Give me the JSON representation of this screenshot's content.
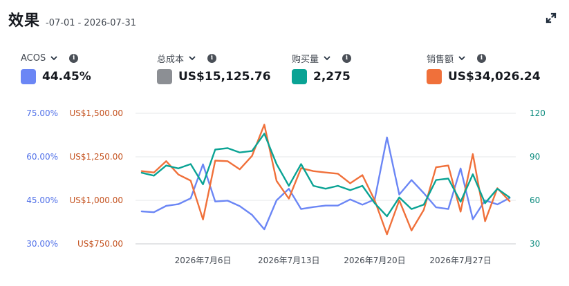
{
  "header": {
    "title": "效果",
    "date_range": "-07-01 - 2026-07-31"
  },
  "metrics": [
    {
      "label": "ACOS",
      "value": "44.45%",
      "color": "#6b86f5"
    },
    {
      "label": "总成本",
      "value": "US$15,125.76",
      "color": "#8c8f94"
    },
    {
      "label": "购买量",
      "value": "2,275",
      "color": "#0aa394"
    },
    {
      "label": "销售额",
      "value": "US$34,026.24",
      "color": "#f0703a"
    }
  ],
  "icons": {
    "expand": "expand-icon",
    "chevron": "chevron-down-icon",
    "info": "info-icon",
    "info_glyph": "i"
  },
  "chart_data": {
    "type": "line",
    "x": [
      "2026-07-01",
      "2026-07-02",
      "2026-07-03",
      "2026-07-04",
      "2026-07-05",
      "2026-07-06",
      "2026-07-07",
      "2026-07-08",
      "2026-07-09",
      "2026-07-10",
      "2026-07-11",
      "2026-07-12",
      "2026-07-13",
      "2026-07-14",
      "2026-07-15",
      "2026-07-16",
      "2026-07-17",
      "2026-07-18",
      "2026-07-19",
      "2026-07-20",
      "2026-07-21",
      "2026-07-22",
      "2026-07-23",
      "2026-07-24",
      "2026-07-25",
      "2026-07-26",
      "2026-07-27",
      "2026-07-28",
      "2026-07-29",
      "2026-07-30",
      "2026-07-31"
    ],
    "x_tick_labels": [
      {
        "x": "2026-07-06",
        "label": "2026年7月6日"
      },
      {
        "x": "2026-07-13",
        "label": "2026年7月13日"
      },
      {
        "x": "2026-07-20",
        "label": "2026年7月20日"
      },
      {
        "x": "2026-07-27",
        "label": "2026年7月27日"
      }
    ],
    "axes": {
      "acos": {
        "side": "left-outer",
        "range": [
          30,
          75
        ],
        "ticks": [
          "30.00%",
          "45.00%",
          "60.00%",
          "75.00%"
        ],
        "tick_values": [
          30,
          45,
          60,
          75
        ],
        "color": "#4f6fe8"
      },
      "sales": {
        "side": "left-inner",
        "range": [
          750,
          1500
        ],
        "ticks": [
          "US$750.00",
          "US$1,000.00",
          "US$1,250.00",
          "US$1,500.00"
        ],
        "tick_values": [
          750,
          1000,
          1250,
          1500
        ],
        "color": "#c4521f"
      },
      "purchases": {
        "side": "right",
        "range": [
          30,
          120
        ],
        "ticks": [
          "30",
          "60",
          "90",
          "120"
        ],
        "tick_values": [
          30,
          60,
          90,
          120
        ],
        "color": "#0a8a7d"
      }
    },
    "grid": true,
    "series": [
      {
        "key": "acos",
        "axis": "acos",
        "color": "#6b86f5",
        "values": [
          41.2,
          40.9,
          43.1,
          43.7,
          45.7,
          57.4,
          44.6,
          44.9,
          43.0,
          40.0,
          35.0,
          45.0,
          49.0,
          42.0,
          42.7,
          43.2,
          43.2,
          45.3,
          43.5,
          45.3,
          66.7,
          47.0,
          52.0,
          47.5,
          42.6,
          42.0,
          56.0,
          38.5,
          45.0,
          43.6,
          45.8
        ]
      },
      {
        "key": "sales",
        "axis": "sales",
        "color": "#f0703a",
        "values": [
          1168,
          1160,
          1225,
          1148,
          1113,
          890,
          1228,
          1225,
          1178,
          1255,
          1435,
          1112,
          1010,
          1185,
          1168,
          1160,
          1153,
          1098,
          1145,
          1000,
          805,
          1000,
          827,
          945,
          1190,
          1200,
          935,
          1266,
          880,
          1070,
          995
        ]
      },
      {
        "key": "purchases",
        "axis": "purchases",
        "color": "#0aa394",
        "values": [
          79,
          77,
          84,
          82,
          85,
          71,
          95,
          96,
          93,
          94,
          106,
          85,
          70,
          85,
          70,
          68,
          70,
          67,
          70,
          58,
          49,
          62,
          54,
          57,
          74,
          75,
          59,
          78,
          58,
          68,
          62
        ]
      }
    ]
  }
}
